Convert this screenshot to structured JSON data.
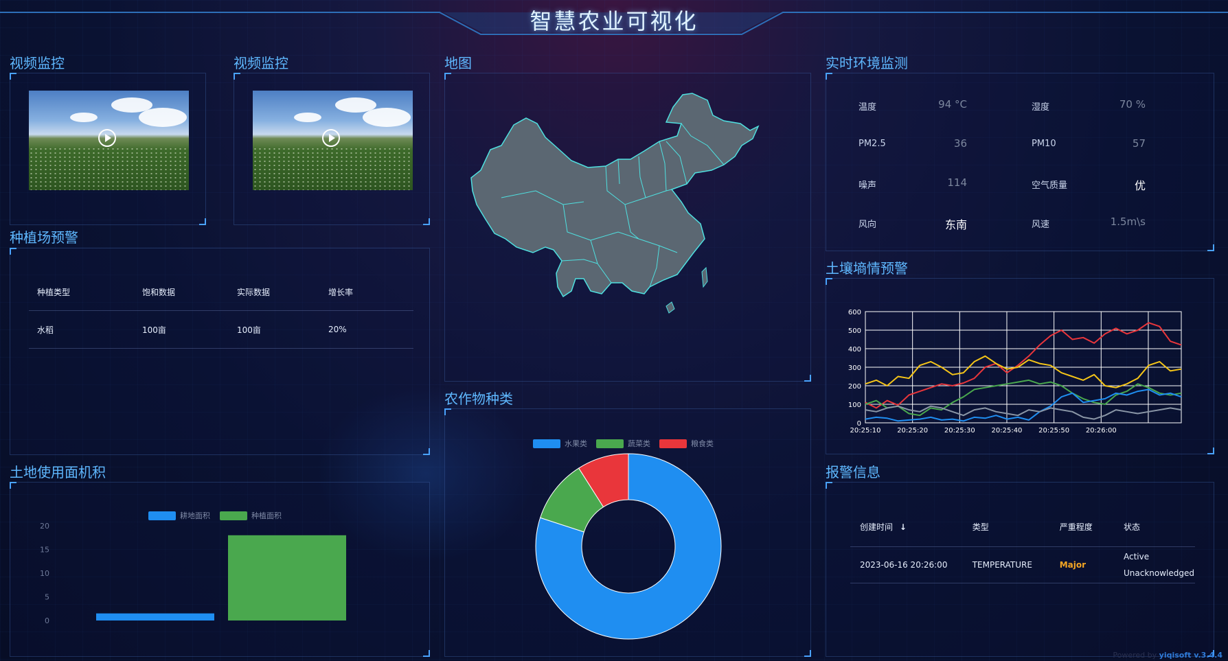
{
  "header": {
    "title": "智慧农业可视化"
  },
  "panels": {
    "video1": "视频监控",
    "video2": "视频监控",
    "map": "地图",
    "env": "实时环境监测",
    "planting": "种植场预警",
    "soil": "土壤墒情预警",
    "crops": "农作物种类",
    "land": "土地使用面机积",
    "alarm": "报警信息"
  },
  "planting_table": {
    "headers": [
      "种植类型",
      "饱和数据",
      "实际数据",
      "增长率"
    ],
    "rows": [
      [
        "水稻",
        "100亩",
        "100亩",
        "20%"
      ]
    ]
  },
  "environment": {
    "items": [
      {
        "label": "温度",
        "value": "94 °C"
      },
      {
        "label": "湿度",
        "value": "70 %"
      },
      {
        "label": "PM2.5",
        "value": "36"
      },
      {
        "label": "PM10",
        "value": "57"
      },
      {
        "label": "噪声",
        "value": "114"
      },
      {
        "label": "空气质量",
        "value": "优"
      },
      {
        "label": "风向",
        "value": "东南"
      },
      {
        "label": "风速",
        "value": "1.5m\\s"
      }
    ]
  },
  "alarm_table": {
    "headers": [
      "创建时间",
      "类型",
      "严重程度",
      "状态"
    ],
    "sort_icon": "arrow-down-icon",
    "rows": [
      {
        "time": "2023-06-16 20:26:00",
        "type": "TEMPERATURE",
        "severity": "Major",
        "status_line1": "Active",
        "status_line2": "Unacknowledged"
      }
    ]
  },
  "colors": {
    "blue": "#1f8ef1",
    "green": "#4aa84e",
    "red": "#e9363b",
    "yellow": "#f5c518",
    "gray": "#8a96a6"
  },
  "chart_data": [
    {
      "type": "line",
      "panel": "土壤墒情预警",
      "x": [
        "20:25:10",
        "20:25:20",
        "20:25:30",
        "20:25:40",
        "20:25:50",
        "20:26:00"
      ],
      "ylim": [
        0,
        600
      ],
      "yticks": [
        "0",
        "100",
        "200",
        "300",
        "400",
        "500",
        "600"
      ],
      "grid": true,
      "series": [
        {
          "color": "#e9363b",
          "values": [
            110,
            80,
            120,
            95,
            150,
            170,
            190,
            210,
            200,
            215,
            240,
            300,
            320,
            270,
            310,
            360,
            420,
            470,
            500,
            450,
            460,
            430,
            480,
            510,
            480,
            500,
            540,
            520,
            440,
            420
          ]
        },
        {
          "color": "#f5c518",
          "values": [
            210,
            230,
            200,
            250,
            240,
            310,
            330,
            300,
            260,
            270,
            330,
            360,
            320,
            290,
            300,
            340,
            320,
            310,
            270,
            250,
            230,
            260,
            200,
            190,
            210,
            240,
            310,
            330,
            280,
            290
          ]
        },
        {
          "color": "#4aa84e",
          "values": [
            100,
            120,
            80,
            90,
            50,
            40,
            80,
            70,
            110,
            140,
            180,
            190,
            200,
            210,
            220,
            230,
            210,
            220,
            200,
            160,
            130,
            110,
            100,
            150,
            170,
            210,
            190,
            160,
            150,
            160
          ]
        },
        {
          "color": "#1f8ef1",
          "values": [
            20,
            30,
            25,
            10,
            15,
            20,
            30,
            15,
            20,
            10,
            30,
            25,
            40,
            20,
            30,
            15,
            60,
            90,
            140,
            160,
            110,
            120,
            130,
            160,
            150,
            170,
            180,
            150,
            160,
            140
          ]
        },
        {
          "color": "#8a96a6",
          "values": [
            70,
            60,
            80,
            90,
            70,
            60,
            90,
            80,
            60,
            40,
            70,
            80,
            60,
            50,
            40,
            70,
            60,
            80,
            70,
            60,
            30,
            20,
            40,
            70,
            60,
            50,
            60,
            70,
            80,
            70
          ]
        }
      ]
    },
    {
      "type": "pie",
      "panel": "农作物种类",
      "categories": [
        "水果类",
        "蔬菜类",
        "粮食类"
      ],
      "values": [
        80,
        11,
        9
      ],
      "colors": [
        "#1f8ef1",
        "#4aa84e",
        "#e9363b"
      ],
      "legend": "top"
    },
    {
      "type": "bar",
      "panel": "土地使用面机积",
      "series": [
        {
          "name": "耕地面积",
          "values": [
            1.5
          ],
          "color": "#1f8ef1"
        },
        {
          "name": "种植面积",
          "values": [
            18
          ],
          "color": "#4aa84e"
        }
      ],
      "ylim": [
        0,
        20
      ],
      "yticks": [
        "0",
        "5",
        "10",
        "15",
        "20"
      ],
      "legend": "top"
    }
  ],
  "footer": {
    "powered_prefix": "Powered by",
    "powered_brand": "yiqisoft v.3.4.4"
  }
}
